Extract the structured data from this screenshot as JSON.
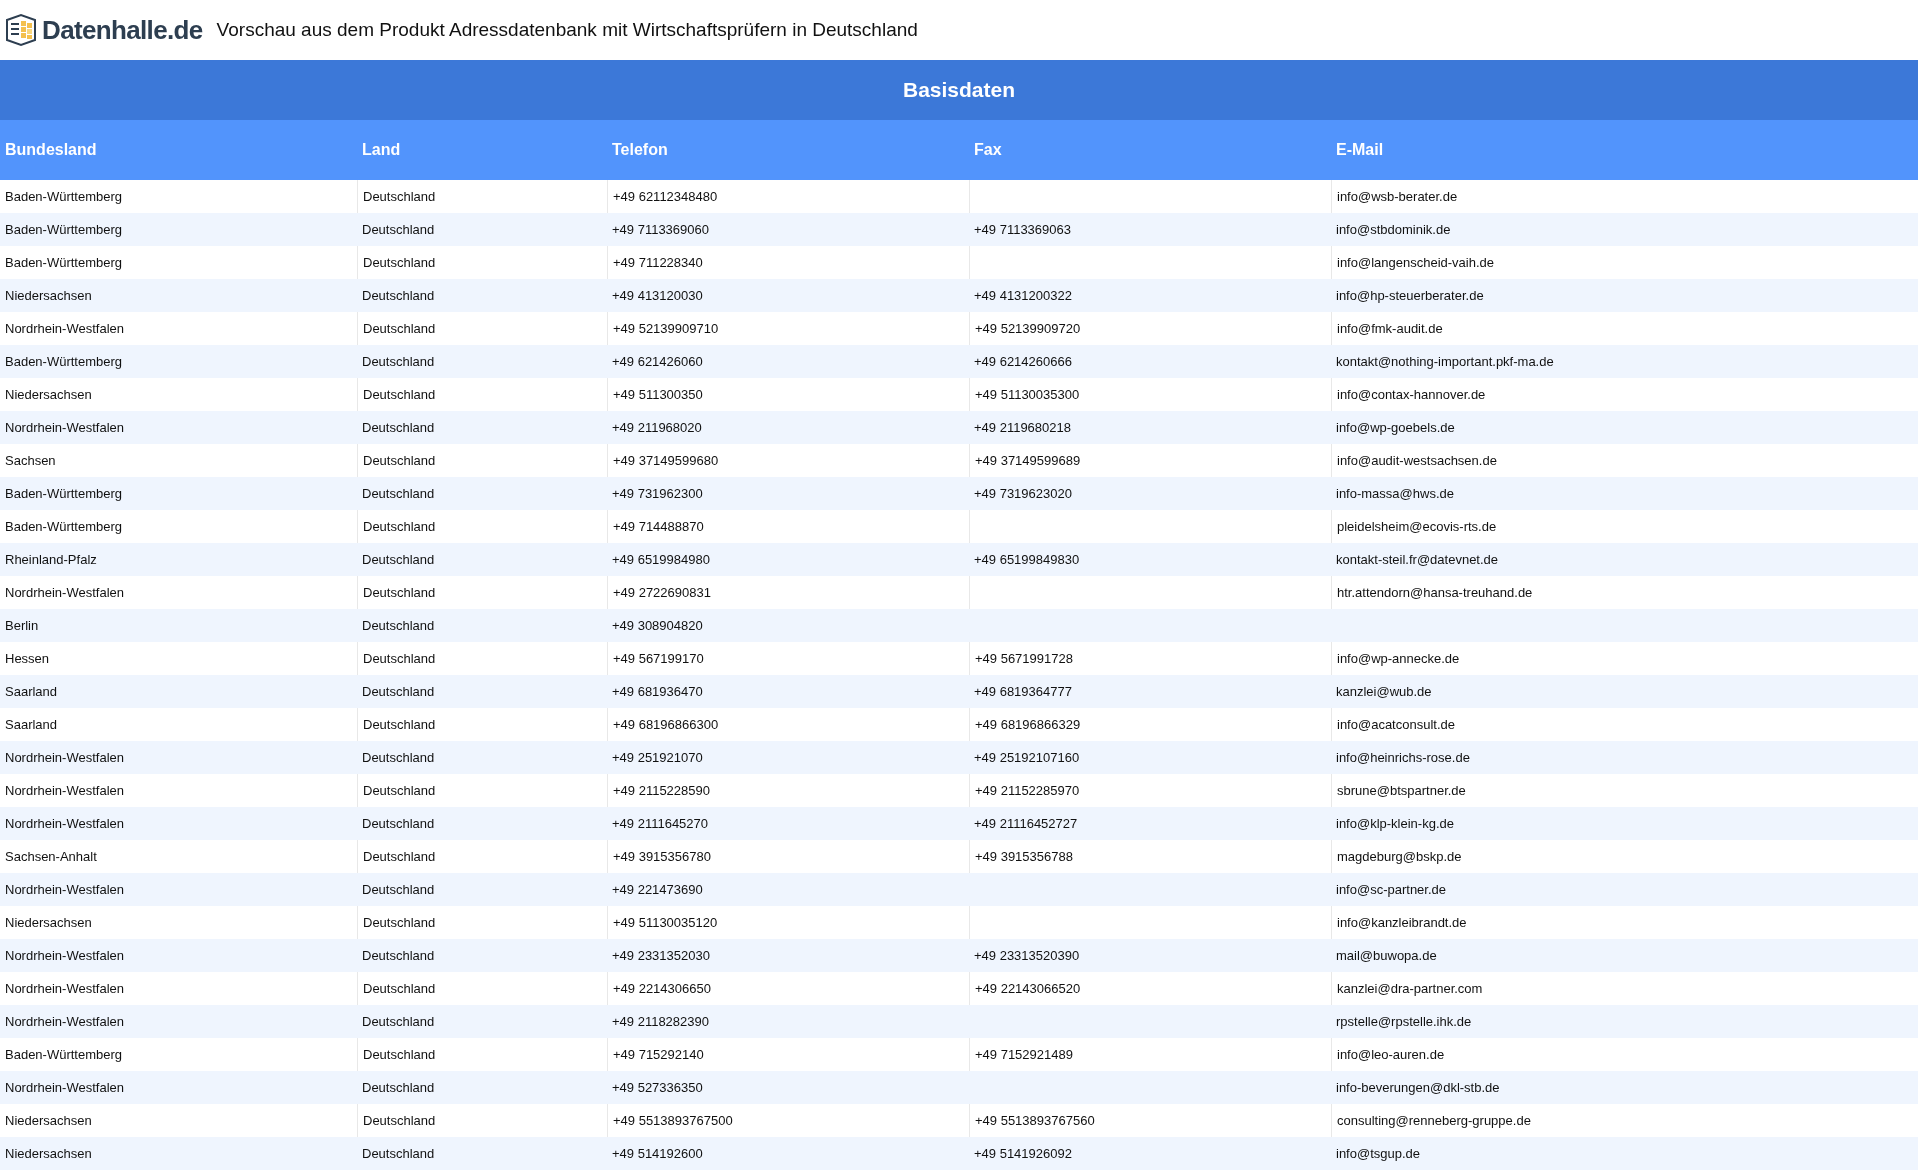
{
  "header": {
    "logo_text": "Datenhalle.de",
    "title": "Vorschau aus dem Produkt Adressdatenbank mit Wirtschaftsprüfern in Deutschland"
  },
  "table": {
    "group_heading": "Basisdaten",
    "columns": [
      "Bundesland",
      "Land",
      "Telefon",
      "Fax",
      "E-Mail"
    ],
    "rows": [
      [
        "Baden-Württemberg",
        "Deutschland",
        "+49 62112348480",
        "",
        "info@wsb-berater.de"
      ],
      [
        "Baden-Württemberg",
        "Deutschland",
        "+49 7113369060",
        "+49 7113369063",
        "info@stbdominik.de"
      ],
      [
        "Baden-Württemberg",
        "Deutschland",
        "+49 711228340",
        "",
        "info@langenscheid-vaih.de"
      ],
      [
        "Niedersachsen",
        "Deutschland",
        "+49 413120030",
        "+49 4131200322",
        "info@hp-steuerberater.de"
      ],
      [
        "Nordrhein-Westfalen",
        "Deutschland",
        "+49 52139909710",
        "+49 52139909720",
        "info@fmk-audit.de"
      ],
      [
        "Baden-Württemberg",
        "Deutschland",
        "+49 621426060",
        "+49 6214260666",
        "kontakt@nothing-important.pkf-ma.de"
      ],
      [
        "Niedersachsen",
        "Deutschland",
        "+49 511300350",
        "+49 51130035300",
        "info@contax-hannover.de"
      ],
      [
        "Nordrhein-Westfalen",
        "Deutschland",
        "+49 211968020",
        "+49 2119680218",
        "info@wp-goebels.de"
      ],
      [
        "Sachsen",
        "Deutschland",
        "+49 37149599680",
        "+49 37149599689",
        "info@audit-westsachsen.de"
      ],
      [
        "Baden-Württemberg",
        "Deutschland",
        "+49 731962300",
        "+49 7319623020",
        "info-massa@hws.de"
      ],
      [
        "Baden-Württemberg",
        "Deutschland",
        "+49 714488870",
        "",
        "pleidelsheim@ecovis-rts.de"
      ],
      [
        "Rheinland-Pfalz",
        "Deutschland",
        "+49 6519984980",
        "+49 65199849830",
        "kontakt-steil.fr@datevnet.de"
      ],
      [
        "Nordrhein-Westfalen",
        "Deutschland",
        "+49 2722690831",
        "",
        "htr.attendorn@hansa-treuhand.de"
      ],
      [
        "Berlin",
        "Deutschland",
        "+49 308904820",
        "",
        ""
      ],
      [
        "Hessen",
        "Deutschland",
        "+49 567199170",
        "+49 5671991728",
        "info@wp-annecke.de"
      ],
      [
        "Saarland",
        "Deutschland",
        "+49 681936470",
        "+49 6819364777",
        "kanzlei@wub.de"
      ],
      [
        "Saarland",
        "Deutschland",
        "+49 68196866300",
        "+49 68196866329",
        "info@acatconsult.de"
      ],
      [
        "Nordrhein-Westfalen",
        "Deutschland",
        "+49 251921070",
        "+49 25192107160",
        "info@heinrichs-rose.de"
      ],
      [
        "Nordrhein-Westfalen",
        "Deutschland",
        "+49 2115228590",
        "+49 21152285970",
        "sbrune@btspartner.de"
      ],
      [
        "Nordrhein-Westfalen",
        "Deutschland",
        "+49 2111645270",
        "+49 21116452727",
        "info@klp-klein-kg.de"
      ],
      [
        "Sachsen-Anhalt",
        "Deutschland",
        "+49 3915356780",
        "+49 3915356788",
        "magdeburg@bskp.de"
      ],
      [
        "Nordrhein-Westfalen",
        "Deutschland",
        "+49 221473690",
        "",
        "info@sc-partner.de"
      ],
      [
        "Niedersachsen",
        "Deutschland",
        "+49 51130035120",
        "",
        "info@kanzleibrandt.de"
      ],
      [
        "Nordrhein-Westfalen",
        "Deutschland",
        "+49 2331352030",
        "+49 23313520390",
        "mail@buwopa.de"
      ],
      [
        "Nordrhein-Westfalen",
        "Deutschland",
        "+49 2214306650",
        "+49 22143066520",
        "kanzlei@dra-partner.com"
      ],
      [
        "Nordrhein-Westfalen",
        "Deutschland",
        "+49 2118282390",
        "",
        "rpstelle@rpstelle.ihk.de"
      ],
      [
        "Baden-Württemberg",
        "Deutschland",
        "+49 715292140",
        "+49 7152921489",
        "info@leo-auren.de"
      ],
      [
        "Nordrhein-Westfalen",
        "Deutschland",
        "+49 527336350",
        "",
        "info-beverungen@dkl-stb.de"
      ],
      [
        "Niedersachsen",
        "Deutschland",
        "+49 5513893767500",
        "+49 5513893767560",
        "consulting@renneberg-gruppe.de"
      ],
      [
        "Niedersachsen",
        "Deutschland",
        "+49 514192600",
        "+49 5141926092",
        "info@tsgup.de"
      ]
    ]
  }
}
